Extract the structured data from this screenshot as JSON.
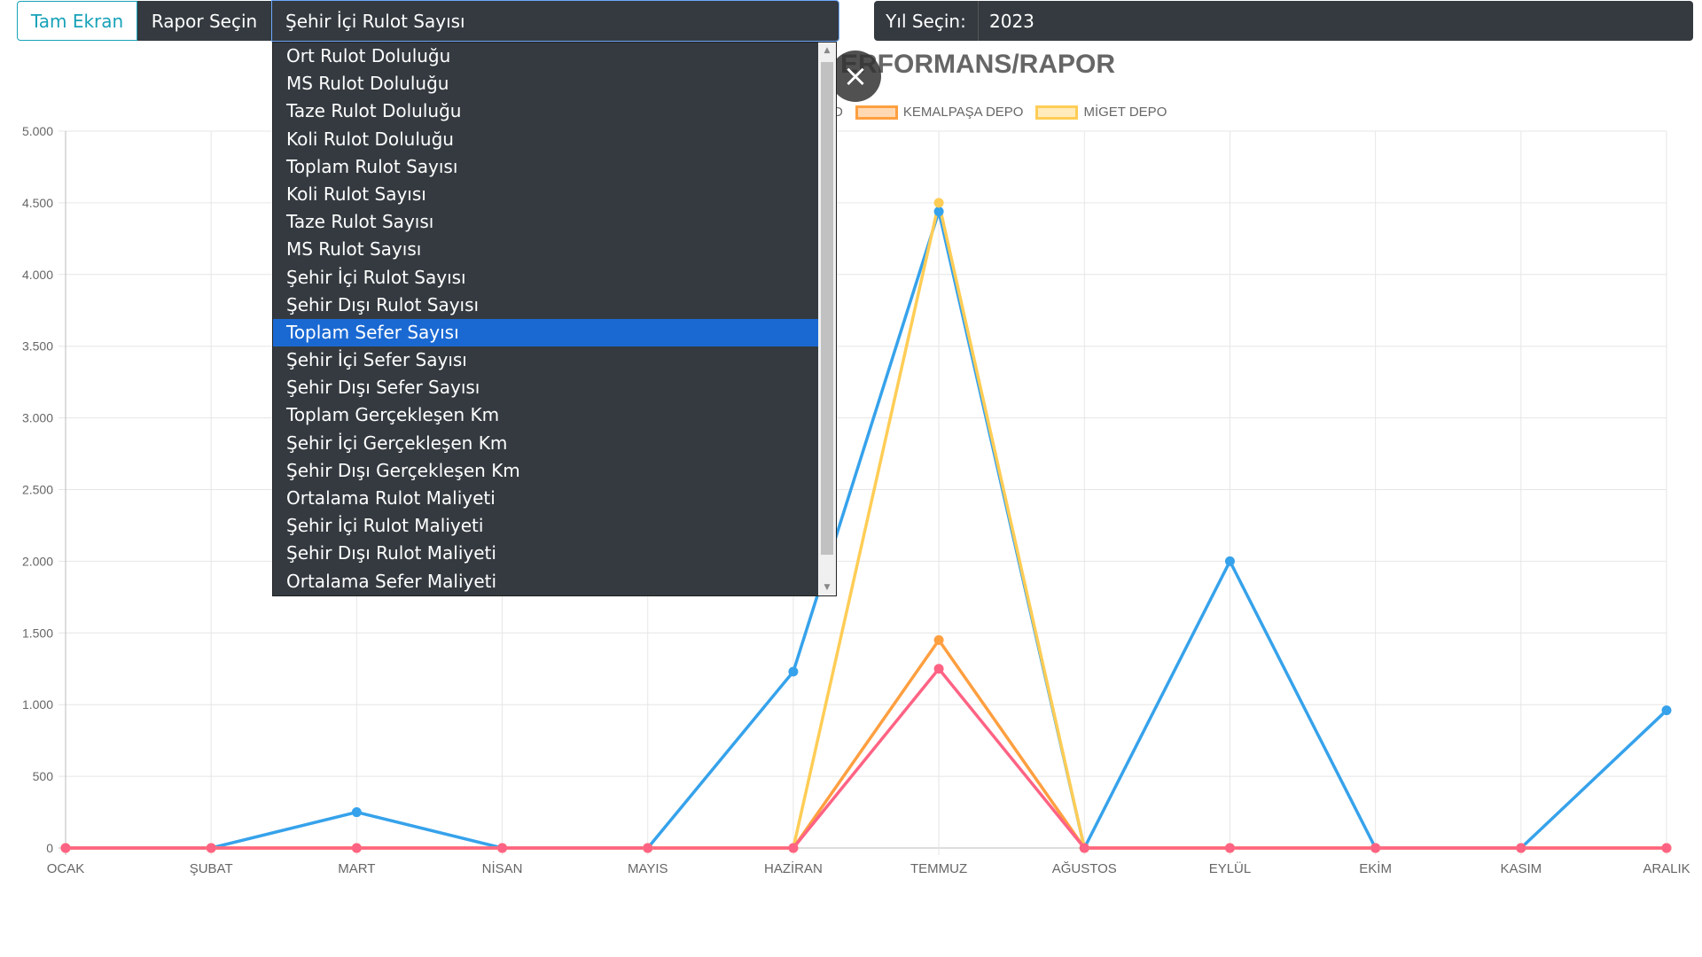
{
  "toolbar": {
    "fullscreen_label": "Tam Ekran",
    "report_label": "Rapor Seçin",
    "report_value": "Şehir İçi Rulot Sayısı",
    "year_label": "Yıl Seçin:",
    "year_value": "2023"
  },
  "chart_title": "ERFORMANS/RAPOR",
  "close_icon": "×",
  "legend": [
    {
      "label": "D",
      "color": "#ff6384"
    },
    {
      "label": "KEMALPAŞA DEPO",
      "color": "#ff9f40"
    },
    {
      "label": "MİGET DEPO",
      "color": "#ffcd56"
    }
  ],
  "dropdown": {
    "items": [
      "Ort Rulot Doluluğu",
      "MS Rulot Doluluğu",
      "Taze Rulot Doluluğu",
      "Koli Rulot Doluluğu",
      "Toplam Rulot Sayısı",
      "Koli Rulot Sayısı",
      "Taze Rulot Sayısı",
      "MS Rulot Sayısı",
      "Şehir İçi Rulot Sayısı",
      "Şehir Dışı Rulot Sayısı",
      "Toplam Sefer Sayısı",
      "Şehir İçi Sefer Sayısı",
      "Şehir Dışı Sefer Sayısı",
      "Toplam Gerçekleşen Km",
      "Şehir İçi Gerçekleşen Km",
      "Şehir Dışı Gerçekleşen Km",
      "Ortalama Rulot Maliyeti",
      "Şehir İçi Rulot Maliyeti",
      "Şehir Dışı Rulot Maliyeti",
      "Ortalama Sefer Maliyeti"
    ],
    "selected_index": 10
  },
  "chart_data": {
    "type": "line",
    "categories": [
      "OCAK",
      "ŞUBAT",
      "MART",
      "NİSAN",
      "MAYIS",
      "HAZİRAN",
      "TEMMUZ",
      "AĞUSTOS",
      "EYLÜL",
      "EKİM",
      "KASIM",
      "ARALIK"
    ],
    "ylim": [
      0,
      5000
    ],
    "yticks": [
      "0",
      "500",
      "1.000",
      "1.500",
      "2.000",
      "2.500",
      "3.000",
      "3.500",
      "4.000",
      "4.500",
      "5.000"
    ],
    "grid": true,
    "series": [
      {
        "color": "#36a2eb",
        "values": [
          0,
          0,
          250,
          0,
          0,
          1230,
          4440,
          0,
          2000,
          0,
          0,
          960
        ]
      },
      {
        "name": "MİGET DEPO",
        "color": "#ffcd56",
        "values": [
          0,
          0,
          0,
          0,
          0,
          0,
          4500,
          0,
          0,
          0,
          0,
          0
        ]
      },
      {
        "name": "KEMALPAŞA DEPO",
        "color": "#ff9f40",
        "values": [
          0,
          0,
          0,
          0,
          0,
          0,
          1450,
          0,
          0,
          0,
          0,
          0
        ]
      },
      {
        "color": "#ff6384",
        "values": [
          0,
          0,
          0,
          0,
          0,
          0,
          1250,
          0,
          0,
          0,
          0,
          0
        ]
      }
    ]
  }
}
